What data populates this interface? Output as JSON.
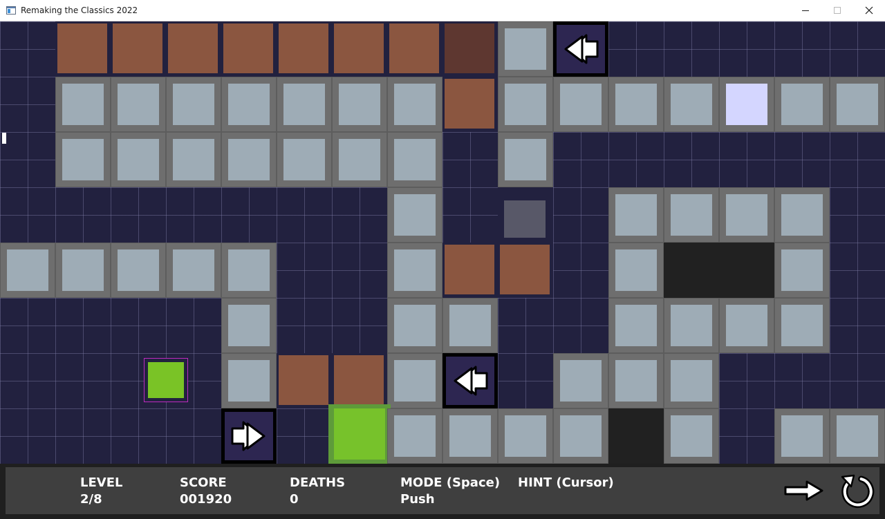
{
  "window": {
    "title": "Remaking the Classics 2022",
    "icons": {
      "app": "app-window-icon",
      "minimize": "minimize-icon",
      "maximize": "maximize-icon",
      "close": "close-icon"
    }
  },
  "board": {
    "colors": {
      "background": "#22213f",
      "floor": "#9eacb6",
      "floor_border": "#6e6e6e",
      "crate": "#8b5640",
      "crate_dark": "#5e3730",
      "pit": "#212121",
      "arrow_tile": "#2d2651",
      "start_tile": "#d4d6ff",
      "exit": "#77c22b",
      "player": "#7ac326",
      "player_outline": "#c02ac0"
    },
    "icons": {
      "arrow_left": "double-arrow-left-icon",
      "arrow_right": "double-arrow-right-icon"
    }
  },
  "hud": {
    "level": {
      "label": "LEVEL",
      "value": "2/8"
    },
    "score": {
      "label": "SCORE",
      "value": "001920"
    },
    "deaths": {
      "label": "DEATHS",
      "value": "0"
    },
    "mode": {
      "label": "MODE (Space)",
      "value": "Push"
    },
    "hint": {
      "label": "HINT (Cursor)"
    },
    "icons": {
      "next": "arrow-right-icon",
      "restart": "restart-icon"
    }
  }
}
